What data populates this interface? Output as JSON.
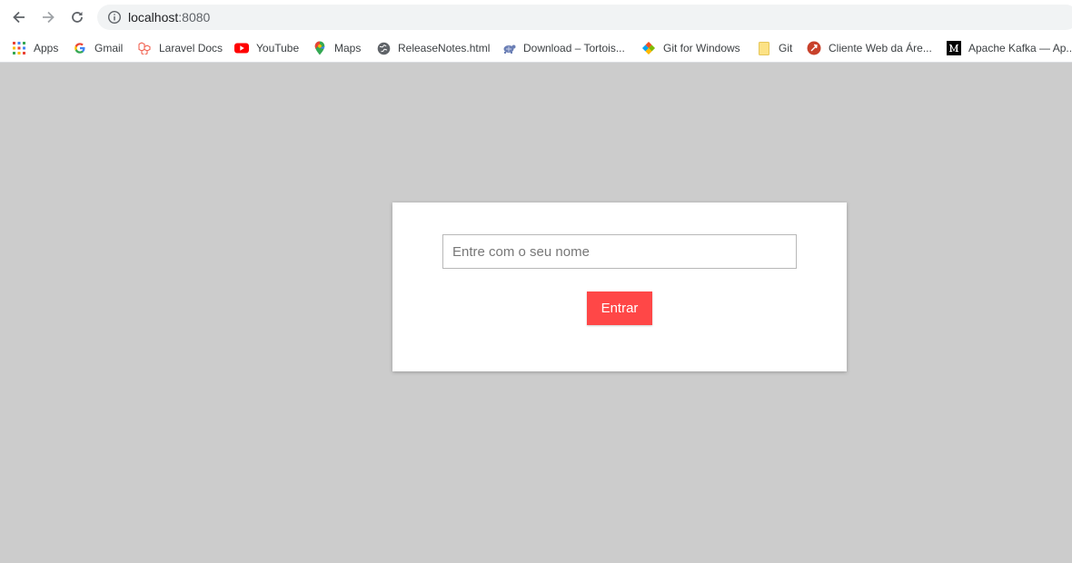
{
  "browser": {
    "url_host": "localhost",
    "url_port": ":8080",
    "bookmarks": [
      {
        "label": "Apps",
        "icon": "apps-grid-icon"
      },
      {
        "label": "Gmail",
        "icon": "google-icon"
      },
      {
        "label": "Laravel Docs",
        "icon": "laravel-icon"
      },
      {
        "label": "YouTube",
        "icon": "youtube-icon"
      },
      {
        "label": "Maps",
        "icon": "maps-pin-icon"
      },
      {
        "label": "ReleaseNotes.html",
        "icon": "globe-icon"
      },
      {
        "label": "Download – Tortois...",
        "icon": "tortoise-icon"
      },
      {
        "label": "Git for Windows",
        "icon": "git-windows-icon"
      },
      {
        "label": "Git",
        "icon": "folder-icon"
      },
      {
        "label": "Cliente Web da Áre...",
        "icon": "web-client-icon"
      },
      {
        "label": "Apache Kafka — Ap...",
        "icon": "medium-icon"
      }
    ]
  },
  "login": {
    "name_placeholder": "Entre com o seu nome",
    "name_value": "",
    "enter_label": "Entrar"
  },
  "colors": {
    "page_background": "#cccccc",
    "button": "#ff4747"
  }
}
